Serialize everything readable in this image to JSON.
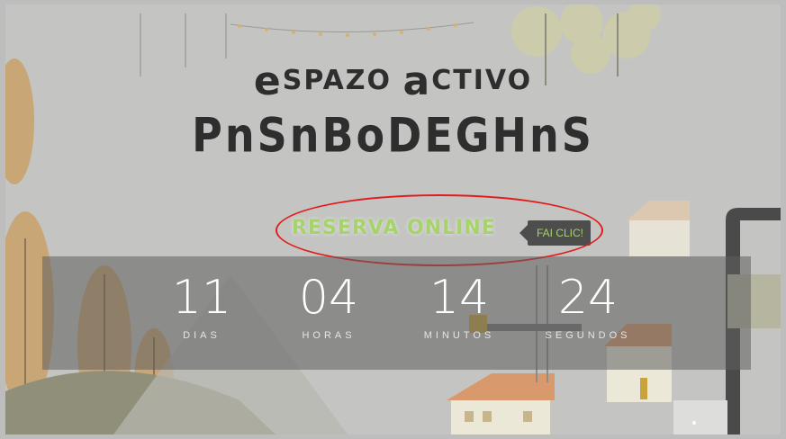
{
  "logo": {
    "line1_initial_1": "e",
    "line1_word_1": "SPAZO",
    "line1_initial_2": "a",
    "line1_word_2": "CTIVO",
    "line2": "PnSnBoDEGHnS"
  },
  "cta": {
    "reserve_label": "RESERVA ONLINE",
    "click_label": "FAI CLIC!"
  },
  "countdown": {
    "units": [
      {
        "value": "11",
        "label": "DIAS"
      },
      {
        "value": "04",
        "label": "HORAS"
      },
      {
        "value": "14",
        "label": "MINUTOS"
      },
      {
        "value": "24",
        "label": "SEGUNDOS"
      }
    ]
  },
  "colors": {
    "accent_green": "#a6d36b",
    "annotation_red": "#e21b1b",
    "logo_dark": "#2e2e2e"
  }
}
